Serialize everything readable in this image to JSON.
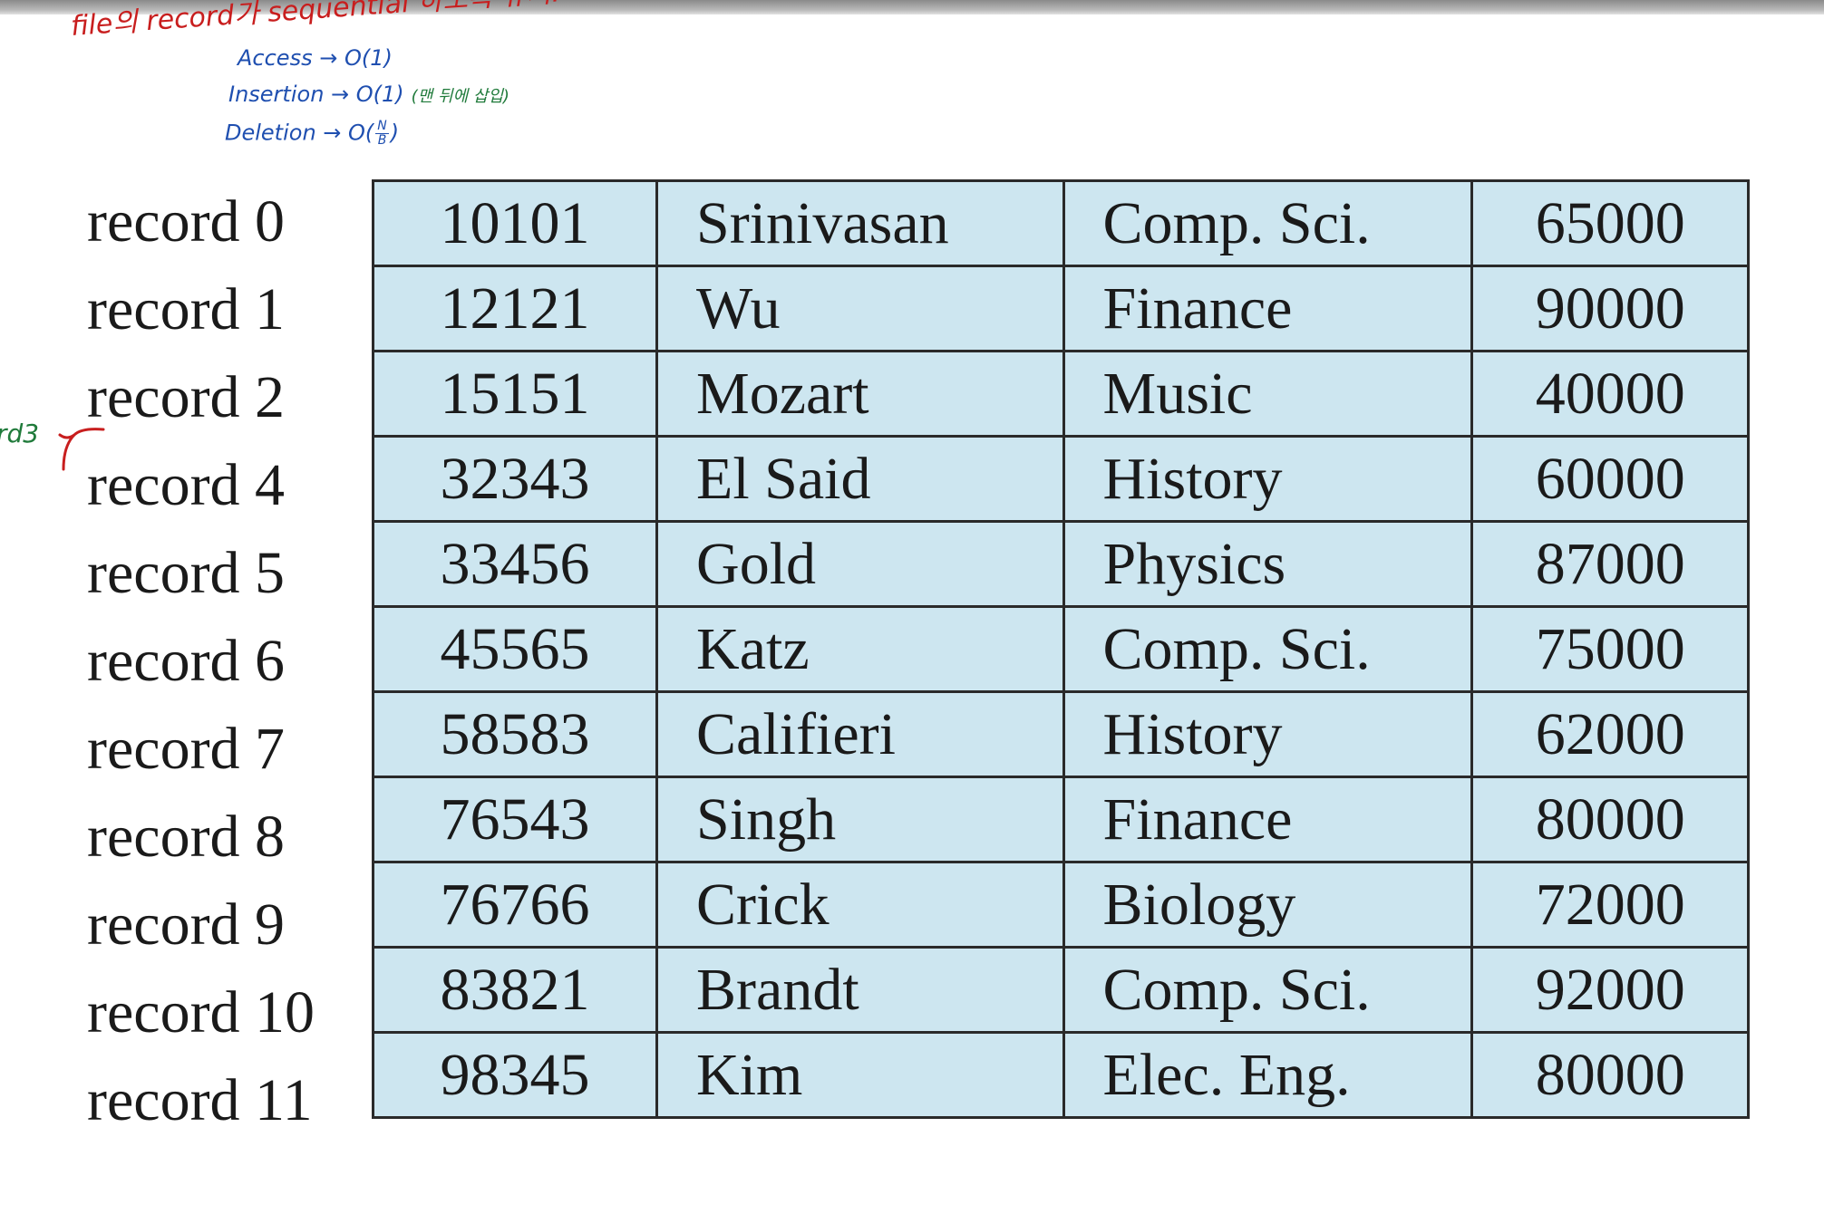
{
  "annotations": {
    "title": "file의 record가 sequential 하도록 유지.",
    "access": "Access → O(1)",
    "insertion": "Insertion → O(1)",
    "insertion_note": "(맨 뒤에 삽입)",
    "deletion_prefix": "Deletion → O(",
    "deletion_num": "N",
    "deletion_den": "B",
    "deletion_suffix": ")",
    "side_mark": "rd3"
  },
  "records": [
    {
      "label": "record 0",
      "id": "10101",
      "name": "Srinivasan",
      "dept": "Comp. Sci.",
      "salary": "65000"
    },
    {
      "label": "record 1",
      "id": "12121",
      "name": "Wu",
      "dept": "Finance",
      "salary": "90000"
    },
    {
      "label": "record 2",
      "id": "15151",
      "name": "Mozart",
      "dept": "Music",
      "salary": "40000"
    },
    {
      "label": "record 4",
      "id": "32343",
      "name": "El Said",
      "dept": "History",
      "salary": "60000"
    },
    {
      "label": "record 5",
      "id": "33456",
      "name": "Gold",
      "dept": "Physics",
      "salary": "87000"
    },
    {
      "label": "record 6",
      "id": "45565",
      "name": "Katz",
      "dept": "Comp. Sci.",
      "salary": "75000"
    },
    {
      "label": "record 7",
      "id": "58583",
      "name": "Califieri",
      "dept": "History",
      "salary": "62000"
    },
    {
      "label": "record 8",
      "id": "76543",
      "name": "Singh",
      "dept": "Finance",
      "salary": "80000"
    },
    {
      "label": "record 9",
      "id": "76766",
      "name": "Crick",
      "dept": "Biology",
      "salary": "72000"
    },
    {
      "label": "record 10",
      "id": "83821",
      "name": "Brandt",
      "dept": "Comp. Sci.",
      "salary": "92000"
    },
    {
      "label": "record 11",
      "id": "98345",
      "name": "Kim",
      "dept": "Elec. Eng.",
      "salary": "80000"
    }
  ],
  "colors": {
    "cell_background": "#cde6f0",
    "border": "#2a2a2a",
    "annotation_red": "#c81e1e",
    "annotation_blue": "#1f4fb0",
    "annotation_green": "#1f7a3a"
  }
}
